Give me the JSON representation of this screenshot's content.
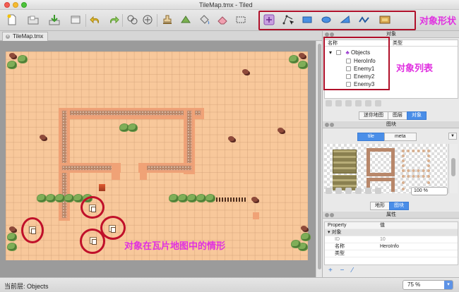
{
  "window": {
    "title": "TileMap.tmx - Tiled"
  },
  "toolbar": {
    "icons": [
      "new-file-icon",
      "open-folder-icon",
      "save-icon",
      "export-icon",
      "undo-icon",
      "redo-icon",
      "random-mode-icon",
      "wang-icon",
      "stamp-brush-icon",
      "terrain-brush-icon",
      "bucket-fill-icon",
      "eraser-icon",
      "rect-select-icon",
      "insert-rect-icon",
      "edit-polygon-icon",
      "insert-object-icon",
      "rectangle-icon",
      "ellipse-icon",
      "polygon-icon",
      "polyline-icon",
      "insert-tile-icon"
    ],
    "shape_annotation": "对象形状"
  },
  "tabs": [
    {
      "label": "TileMap.tmx"
    }
  ],
  "map": {
    "annotation": "对象在瓦片地图中的情形",
    "colors": {
      "ground": "#f8c89b",
      "wall": "#b8876a",
      "ring": "#c0102a"
    }
  },
  "objects_panel": {
    "title": "对象",
    "col_name": "名称",
    "col_type": "类型",
    "group": "Objects",
    "items": [
      "HeroInfo",
      "Enemy1",
      "Enemy2",
      "Enemy3"
    ],
    "annotation": "对象列表"
  },
  "panel_tabs_top": [
    "迷你地图",
    "图层",
    "对象"
  ],
  "tiles_panel": {
    "title": "图块",
    "tabs": [
      "tile",
      "meta"
    ],
    "zoom": "100 %"
  },
  "panel_tabs_bottom": [
    "地形",
    "图块"
  ],
  "props_panel": {
    "title": "属性",
    "col_prop": "Property",
    "col_val": "值",
    "section": "对象",
    "rows": [
      {
        "k": "ID",
        "v": "10"
      },
      {
        "k": "名称",
        "v": "HeroInfo"
      },
      {
        "k": "类型",
        "v": ""
      }
    ]
  },
  "status": {
    "layer": "当前层: Objects",
    "zoom": "75 %"
  }
}
